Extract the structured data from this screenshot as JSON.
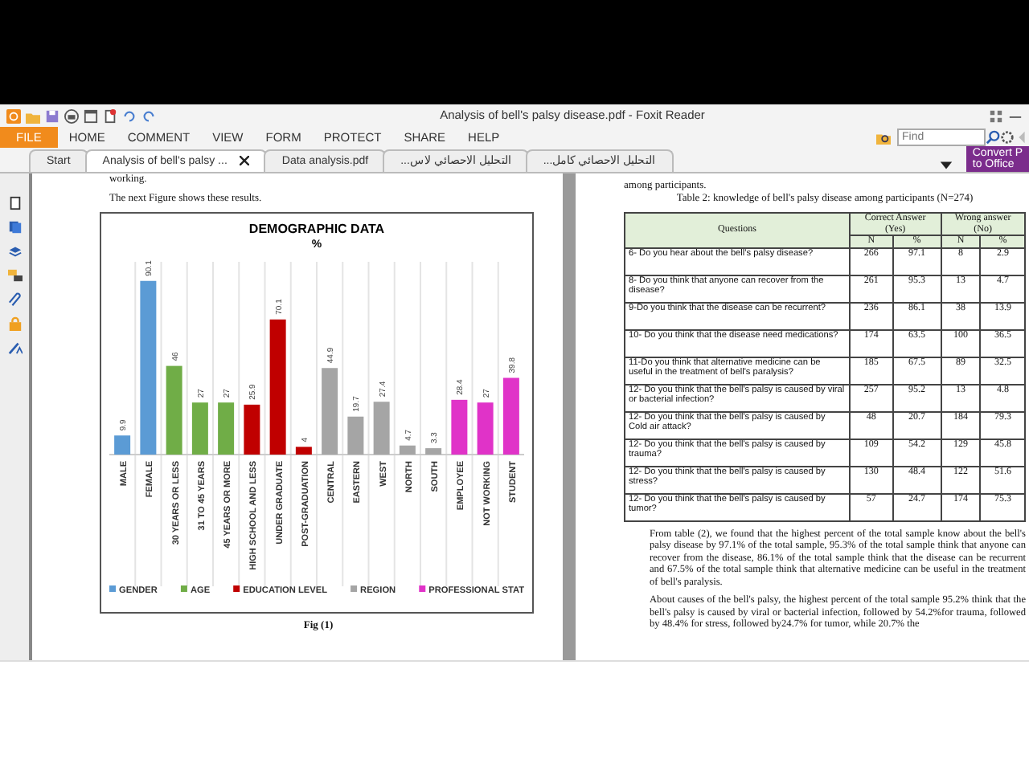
{
  "window": {
    "title": "Analysis of bell's palsy disease.pdf - Foxit Reader"
  },
  "menu": [
    {
      "label": "FILE",
      "selected": true
    },
    {
      "label": "HOME",
      "selected": false
    },
    {
      "label": "COMMENT",
      "selected": false
    },
    {
      "label": "VIEW",
      "selected": false
    },
    {
      "label": "FORM",
      "selected": false
    },
    {
      "label": "PROTECT",
      "selected": false
    },
    {
      "label": "SHARE",
      "selected": false
    },
    {
      "label": "HELP",
      "selected": false
    }
  ],
  "search": {
    "placeholder": "Find"
  },
  "convert_button": {
    "line_1": "Convert P",
    "line_2": "to Office"
  },
  "tabs": [
    {
      "label": "Start",
      "selected": false,
      "closable": false
    },
    {
      "label": "Analysis of bell's palsy ...",
      "selected": true,
      "closable": true
    },
    {
      "label": "Data analysis.pdf",
      "selected": false,
      "closable": false
    },
    {
      "label": "التحليل الاحصائي لاس...",
      "selected": false,
      "closable": false
    },
    {
      "label": "التحليل الاحصائي كامل...",
      "selected": false,
      "closable": false
    }
  ],
  "left_page": {
    "top_text": "working.",
    "intro": "The next Figure shows these results.",
    "caption": "Fig (1)",
    "chart_data": {
      "type": "bar",
      "title": "DEMOGRAPHIC DATA",
      "ylabel": "%",
      "data_labels": true,
      "legend": true,
      "categories": [
        "MALE",
        "FEMALE",
        "30 YEARS OR LESS",
        "31 TO 45 YEARS",
        "45 YEARS OR MORE",
        "HIGH SCHOOL AND LESS",
        "UNDER GRADUATE",
        "POST-GRADUATION",
        "CENTRAL",
        "EASTERN",
        "WEST",
        "NORTH",
        "SOUTH",
        "EMPLOYEE",
        "NOT WORKING",
        "STUDENT"
      ],
      "series": [
        {
          "name": "GENDER",
          "color": "#5b9bd5",
          "values": [
            9.9,
            90.1,
            null,
            null,
            null,
            null,
            null,
            null,
            null,
            null,
            null,
            null,
            null,
            null,
            null,
            null
          ]
        },
        {
          "name": "AGE",
          "color": "#70ad47",
          "values": [
            null,
            null,
            46,
            27,
            27,
            null,
            null,
            null,
            null,
            null,
            null,
            null,
            null,
            null,
            null,
            null
          ]
        },
        {
          "name": "EDUCATION LEVEL",
          "color": "#c00000",
          "values": [
            null,
            null,
            null,
            null,
            null,
            25.9,
            70.1,
            4,
            null,
            null,
            null,
            null,
            null,
            null,
            null,
            null
          ]
        },
        {
          "name": "REGION",
          "color": "#a5a5a5",
          "values": [
            null,
            null,
            null,
            null,
            null,
            null,
            null,
            null,
            44.9,
            19.7,
            27.4,
            4.7,
            3.3,
            null,
            null,
            null
          ]
        },
        {
          "name": "PROFESSIONAL STAT",
          "color": "#e033c8",
          "values": [
            null,
            null,
            null,
            null,
            null,
            null,
            null,
            null,
            null,
            null,
            null,
            null,
            null,
            28.4,
            27,
            39.8
          ]
        }
      ]
    }
  },
  "right_page": {
    "top_text": "among participants.",
    "table_title": "Table 2: knowledge of bell's palsy disease among participants (N=274)",
    "table": {
      "column_groups": [
        {
          "label": "Correct Answer (Yes)"
        },
        {
          "label": "Wrong answer (No)"
        }
      ],
      "columns": [
        "Questions",
        "N",
        "%",
        "N",
        "%"
      ],
      "rows": [
        [
          "6- Do you hear about the bell's palsy disease?",
          "266",
          "97.1",
          "8",
          "2.9"
        ],
        [
          "8- Do you think that anyone can recover from the disease?",
          "261",
          "95.3",
          "13",
          "4.7"
        ],
        [
          "9-Do you think that the disease can be recurrent?",
          "236",
          "86.1",
          "38",
          "13.9"
        ],
        [
          "10- Do you think that the disease need medications?",
          "174",
          "63.5",
          "100",
          "36.5"
        ],
        [
          "11-Do you think that alternative medicine can be useful in the treatment of bell's paralysis?",
          "185",
          "67.5",
          "89",
          "32.5"
        ],
        [
          "12- Do you think that the bell's palsy is caused by viral or bacterial infection?",
          "257",
          "95.2",
          "13",
          "4.8"
        ],
        [
          "12- Do you think that the bell's palsy is caused by Cold air attack?",
          "48",
          "20.7",
          "184",
          "79.3"
        ],
        [
          "12- Do you think that the bell's palsy is caused by trauma?",
          "109",
          "54.2",
          "129",
          "45.8"
        ],
        [
          "12- Do you think that the bell's palsy is caused by stress?",
          "130",
          "48.4",
          "122",
          "51.6"
        ],
        [
          "12- Do you think that the bell's palsy is caused by tumor?",
          "57",
          "24.7",
          "174",
          "75.3"
        ]
      ]
    },
    "paragraphs": [
      "From table (2), we found that the highest percent of the total sample know about the bell's palsy disease by 97.1% of the total sample, 95.3% of the total sample think that anyone can recover from the disease, 86.1% of the total sample think that the disease can be recurrent and 67.5% of the total sample think that alternative medicine can be useful in the treatment of bell's paralysis.",
      "About causes of the bell's palsy, the highest percent of the total sample 95.2% think that the bell's palsy is caused by viral or bacterial infection, followed by 54.2%for trauma, followed by 48.4% for stress, followed by24.7% for tumor, while 20.7% the"
    ]
  }
}
